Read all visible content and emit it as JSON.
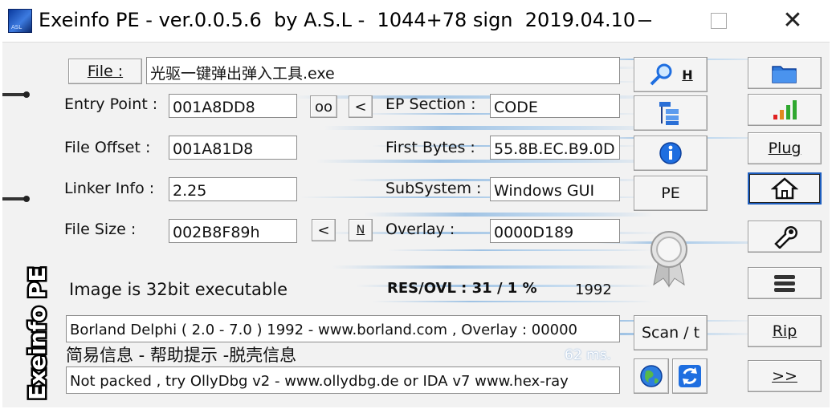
{
  "window": {
    "title": "Exeinfo PE - ver.0.0.5.6  by A.S.L -  1044+78 sign  2019.04.10",
    "minimize_icon": "minimize-icon",
    "maximize_icon": "maximize-icon",
    "close_glyph": "✕"
  },
  "file": {
    "button_label": "File :",
    "path": "光驱一键弹出弹入工具.exe"
  },
  "labels": {
    "entry_point": "Entry Point :",
    "file_offset": "File Offset :",
    "linker_info": "Linker Info :",
    "file_size": "File Size :",
    "ep_section": "EP Section :",
    "first_bytes": "First Bytes :",
    "subsystem": "SubSystem :",
    "overlay": "Overlay :"
  },
  "values": {
    "entry_point": "001A8DD8",
    "file_offset": "001A81D8",
    "linker_info": "2.25",
    "file_size": "002B8F89h",
    "ep_section": "CODE",
    "first_bytes": "55.8B.EC.B9.0D",
    "subsystem": "Windows GUI",
    "overlay": "0000D189"
  },
  "small_buttons": {
    "oo": "oo",
    "prev_ep": "<",
    "prev_size": "<",
    "n": "N"
  },
  "info": {
    "image_type": "Image is 32bit executable",
    "res_ovl": "RES/OVL : 31 / 1 %",
    "year": "1992",
    "detection": "Borland Delphi ( 2.0 - 7.0 ) 1992 - www.borland.com , Overlay : 00000",
    "help_text": "简易信息 - 帮助提示 -脱壳信息",
    "timing": "62 ms.",
    "packer_hint": "Not packed , try OllyDbg v2 - www.ollydbg.de or IDA v7 www.hex-ray"
  },
  "side_label": "Exeinfo PE",
  "middle_buttons": {
    "search_h": "H",
    "pe": "PE",
    "scan": "Scan / t"
  },
  "right_buttons": {
    "plug": "Plug",
    "rip": "Rip",
    "next": ">>"
  },
  "colors": {
    "background": "#f2f2f2",
    "accent_blue": "#1e6ee0",
    "streak_blue": "#6fa8dc",
    "selected_border": "#1f5fbf"
  }
}
